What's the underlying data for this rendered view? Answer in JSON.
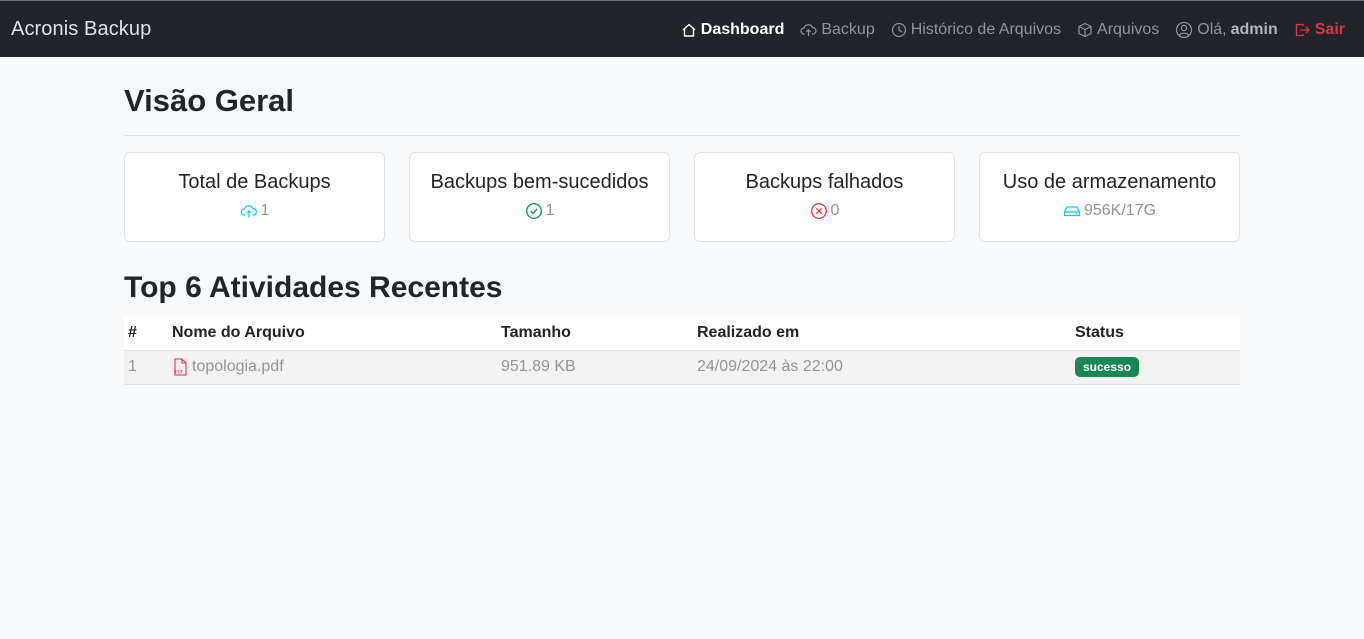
{
  "navbar": {
    "brand": "Acronis Backup",
    "links": {
      "dashboard": "Dashboard",
      "backup": "Backup",
      "history": "Histórico de Arquivos",
      "files": "Arquivos",
      "greeting": "Olá,",
      "username": "admin",
      "logout": "Sair"
    }
  },
  "overview": {
    "title": "Visão Geral",
    "cards": [
      {
        "title": "Total de Backups",
        "value": "1",
        "icon": "cloud-upload-icon",
        "icon_color": "#0dcaf0"
      },
      {
        "title": "Backups bem-sucedidos",
        "value": "1",
        "icon": "check-circle-icon",
        "icon_color": "#198754"
      },
      {
        "title": "Backups falhados",
        "value": "0",
        "icon": "x-circle-icon",
        "icon_color": "#dc3545"
      },
      {
        "title": "Uso de armazenamento",
        "value": "956K/17G",
        "icon": "hdd-icon",
        "icon_color": "#0dcaf0"
      }
    ]
  },
  "recent": {
    "title": "Top 6 Atividades Recentes",
    "columns": [
      "#",
      "Nome do Arquivo",
      "Tamanho",
      "Realizado em",
      "Status"
    ],
    "rows": [
      {
        "index": "1",
        "file": "topologia.pdf",
        "file_icon": "pdf-file-icon",
        "size": "951.89 KB",
        "date": "24/09/2024 às 22:00",
        "status": "sucesso",
        "status_color": "#198754"
      }
    ]
  }
}
